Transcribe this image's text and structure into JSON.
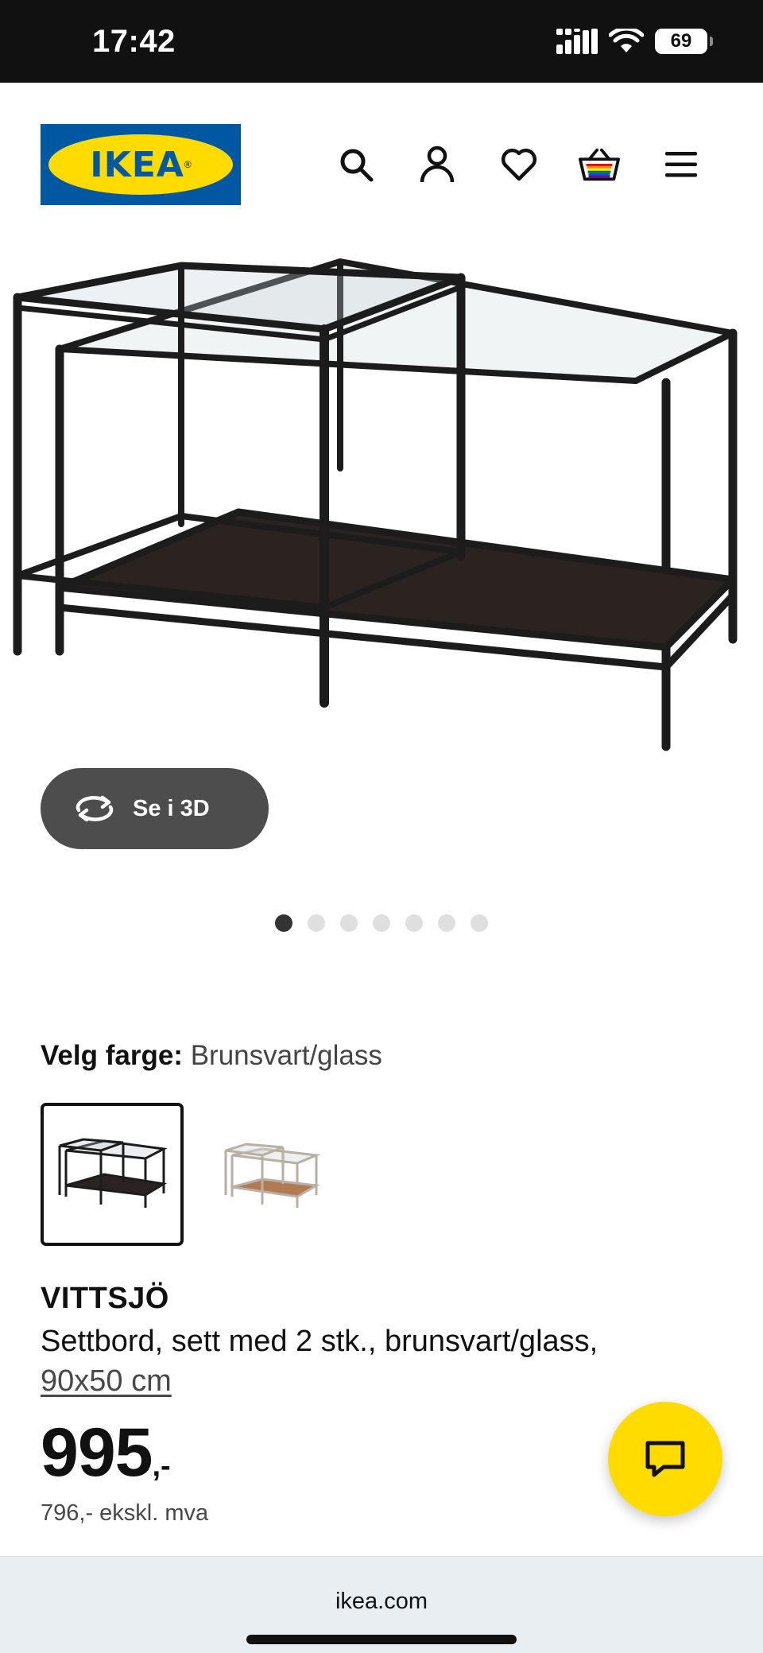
{
  "status_bar": {
    "time": "17:42",
    "battery": "69"
  },
  "header": {
    "logo_text": "IKEA",
    "icons": [
      "search-icon",
      "account-icon",
      "heart-icon",
      "basket-icon",
      "menu-icon"
    ]
  },
  "gallery": {
    "view_3d_label": "Se i 3D",
    "image_count": 7,
    "active_index": 0
  },
  "color_picker": {
    "label": "Velg farge:",
    "value": "Brunsvart/glass",
    "selected_index": 0
  },
  "product": {
    "name": "VITTSJÖ",
    "description": "Settbord, sett med 2 stk., brunsvart/glass,",
    "size": "90x50 cm",
    "price_int": "995",
    "price_suffix": ",-",
    "price_ex_vat": "796,- ekskl. mva"
  },
  "browser": {
    "url": "ikea.com"
  },
  "colors": {
    "ikea_blue": "#0058a3",
    "ikea_yellow": "#ffdb00",
    "button_grey": "#4d4d4d"
  }
}
